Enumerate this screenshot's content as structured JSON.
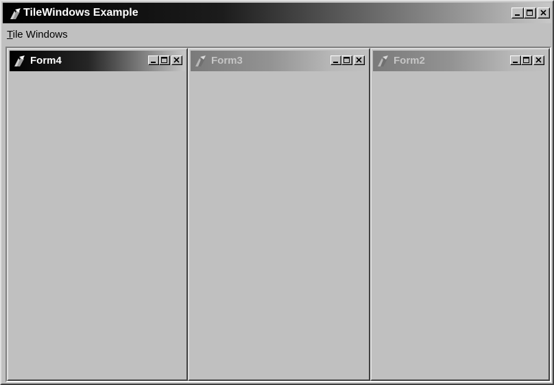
{
  "window": {
    "title": "TileWindows Example",
    "icon": "app-icon",
    "buttons": [
      "minimize-icon",
      "maximize-icon",
      "close-icon"
    ]
  },
  "menubar": {
    "items": [
      {
        "label_accel": "T",
        "label_rest": "ile Windows"
      }
    ]
  },
  "children": [
    {
      "title": "Form4",
      "state": "active"
    },
    {
      "title": "Form3",
      "state": "inactive"
    },
    {
      "title": "Form2",
      "state": "inactive"
    }
  ],
  "colors": {
    "face": "#c0c0c0",
    "active_title_start": "#000000",
    "inactive_title_start": "#7a7a7a",
    "inactive_title_text": "#c6c6c6"
  }
}
